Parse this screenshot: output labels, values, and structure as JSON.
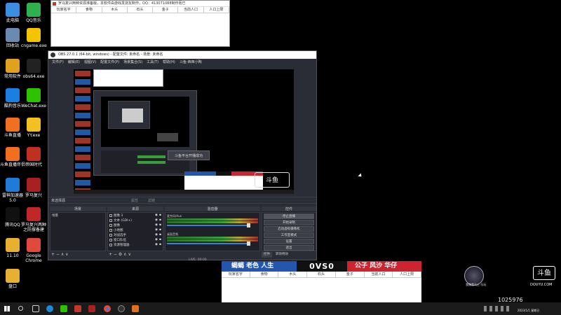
{
  "desktop_icons": [
    {
      "label": "此电脑",
      "color": "#3b8ee0"
    },
    {
      "label": "QQ音乐",
      "color": "#2fb24c"
    },
    {
      "label": "回收站",
      "color": "#6a8bb0"
    },
    {
      "label": "cngame.exe",
      "color": "#f4c400"
    },
    {
      "label": "常用软件",
      "color": "#e0a020"
    },
    {
      "label": "obs64.exe",
      "color": "#222222"
    },
    {
      "label": "酷狗音乐",
      "color": "#1a7fe0"
    },
    {
      "label": "WeChat.exe",
      "color": "#2dc100"
    },
    {
      "label": "斗鱼直播",
      "color": "#f07020"
    },
    {
      "label": "YY.exe",
      "color": "#f2c020"
    },
    {
      "label": "斗鱼直播伴侣",
      "color": "#f07020"
    },
    {
      "label": "帝国时代",
      "color": "#c03020"
    },
    {
      "label": "雷神加速器\n5.0",
      "color": "#1f7ad8"
    },
    {
      "label": "罗马复兴",
      "color": "#a82020"
    },
    {
      "label": "腾讯QQ",
      "color": "#111111"
    },
    {
      "label": "罗马复兴两种之防撑备建",
      "color": "#c02828"
    },
    {
      "label": "11.10",
      "color": "#e8b030"
    },
    {
      "label": "Google\nChrome",
      "color": "#e04a3a"
    },
    {
      "label": "盘口",
      "color": "#e8b030"
    }
  ],
  "resource_window": {
    "title": "罗马复兴两种资源准备版，本软件由游戏发烧友制作，QQ：413071088制作而已",
    "columns": [
      "玩家名字",
      "食物",
      "木头",
      "石头",
      "金子",
      "当前人口",
      "人口上限"
    ]
  },
  "obs": {
    "title": "OBS 27.0.1 (64-bit, windows) - 配置文件: 未命名 - 场景: 未命名",
    "menu": [
      "文件(F)",
      "编辑(E)",
      "视图(V)",
      "配置文件(P)",
      "场景集合(S)",
      "工具(T)",
      "帮助(H)",
      "斗鱼-西西小陶"
    ],
    "no_source": "未选择源",
    "properties": "属性",
    "filters": "滤镜",
    "scenes_header": "场景",
    "scenes": [
      "场景"
    ],
    "sources_header": "来源",
    "sources": [
      "图像 3",
      "文本 (GDI+)",
      "图像",
      "小地图",
      "对战选手",
      "窗口队伍",
      "资源管理器"
    ],
    "mixer_header": "混音器",
    "mixer": [
      {
        "name": "麦克风/Aux",
        "db": "0.0 dB"
      },
      {
        "name": "桌面音频",
        "db": "0.0 dB"
      }
    ],
    "controls_header": "控件",
    "controls": [
      "停止直播",
      "开始录制",
      "启动虚拟摄像机",
      "工作室模式",
      "设置",
      "退出"
    ],
    "tabs": [
      "控件",
      "转场特效"
    ],
    "status": "LIVE: 00:00"
  },
  "preview_popup": "斗鱼平台开播成功",
  "overlay": {
    "left_names": "蝎蝎  老色  人生",
    "vs": "0VS0",
    "right_names": "公子  风沙  华仔",
    "columns": [
      "玩家名字",
      "食物",
      "木头",
      "石头",
      "金子",
      "当前人口",
      "人口上限"
    ]
  },
  "streamer": {
    "name": "我像是马上 乐玩",
    "brand": "斗鱼",
    "site": "DOUYU.COM",
    "room": "1025976"
  },
  "taskbar": {
    "time": "",
    "date": "2023/1/1 星期日"
  }
}
